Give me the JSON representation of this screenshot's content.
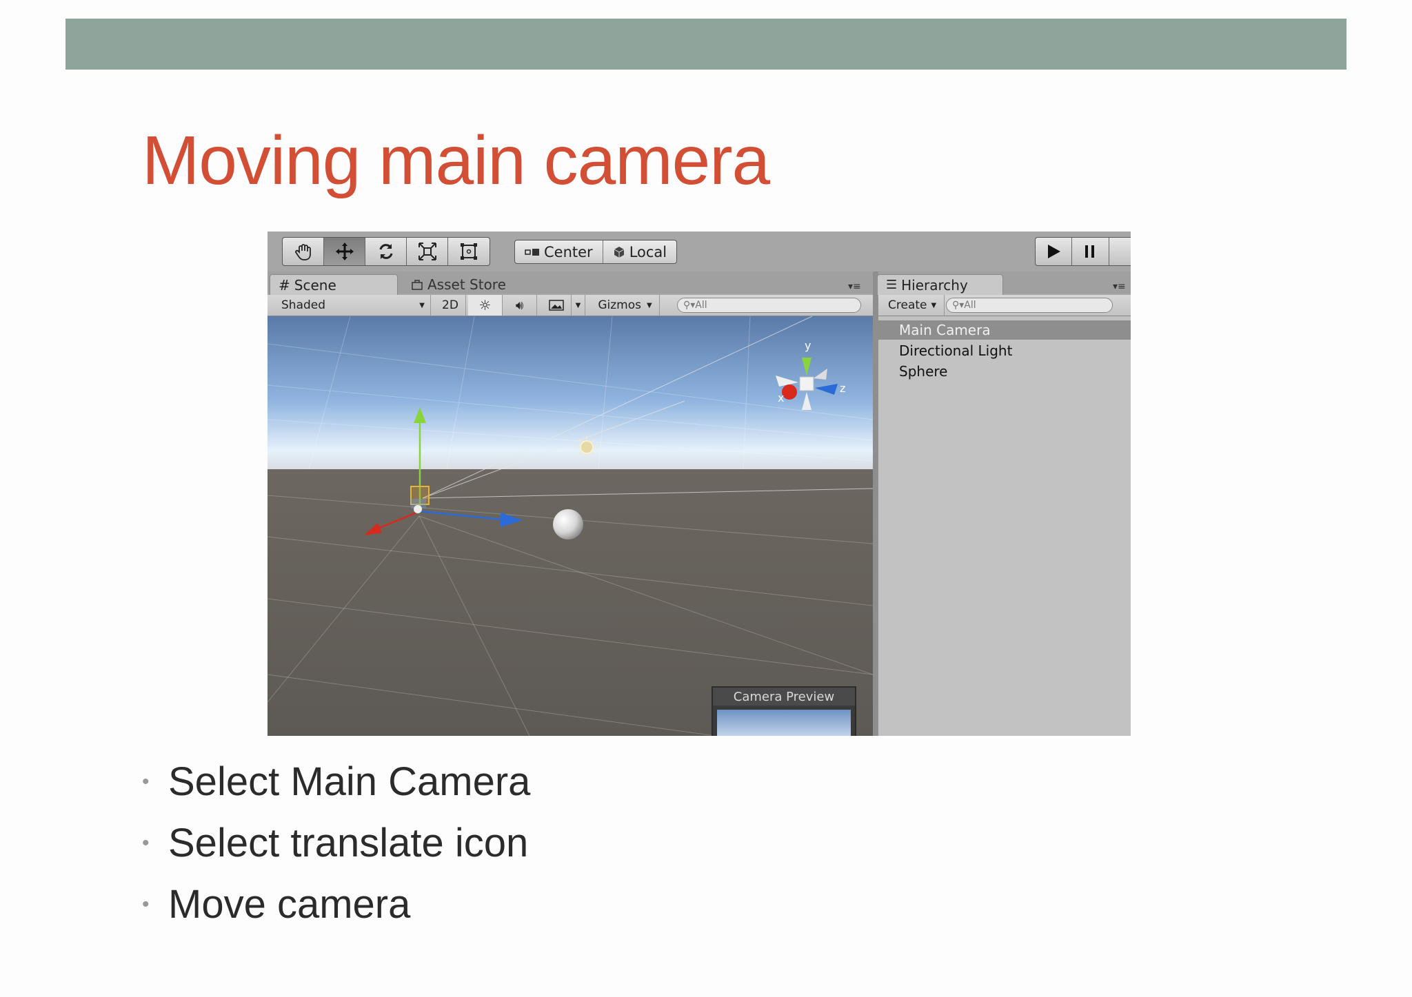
{
  "slide": {
    "title": "Moving main camera",
    "bullets": [
      "Select Main Camera",
      "Select translate icon",
      "Move camera"
    ]
  },
  "toolbar": {
    "tools": [
      {
        "icon": "hand-icon"
      },
      {
        "icon": "move-icon",
        "active": true
      },
      {
        "icon": "rotate-icon"
      },
      {
        "icon": "scale-icon"
      },
      {
        "icon": "rect-icon"
      }
    ],
    "pivot_label": "Center",
    "space_label": "Local",
    "play_icon": "play-icon",
    "pause_icon": "pause-icon"
  },
  "scene_panel": {
    "tabs": {
      "scene": "Scene",
      "asset_store": "Asset Store"
    },
    "draw_mode": "Shaded",
    "mode_2d": "2D",
    "gizmos_label": "Gizmos",
    "search_placeholder": "All",
    "gizmo_axes": {
      "x": "x",
      "y": "y",
      "z": "z"
    },
    "camera_preview_title": "Camera Preview"
  },
  "hierarchy": {
    "tab": "Hierarchy",
    "create_label": "Create",
    "search_placeholder": "All",
    "items": [
      "Main Camera",
      "Directional Light",
      "Sphere"
    ],
    "selected_index": 0
  },
  "colors": {
    "title": "#d24f36",
    "band": "#8fa49b",
    "axis_x": "#d8291c",
    "axis_y": "#8ad43b",
    "axis_z": "#2a6bd8"
  }
}
